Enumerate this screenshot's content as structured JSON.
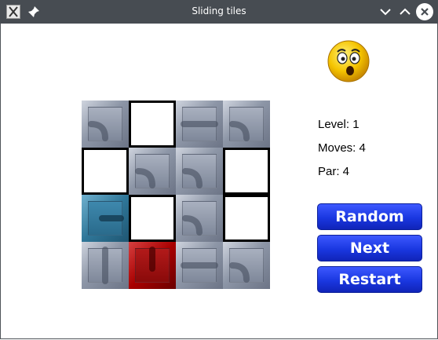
{
  "window": {
    "title": "Sliding tiles",
    "title_bar_color": "#474c52"
  },
  "board": {
    "rows": 4,
    "cols": 4,
    "tiles": [
      {
        "kind": "gray",
        "pipe": "curve"
      },
      {
        "kind": "empty",
        "pipe": "none"
      },
      {
        "kind": "gray",
        "pipe": "horizontal"
      },
      {
        "kind": "gray",
        "pipe": "curve"
      },
      {
        "kind": "empty",
        "pipe": "none"
      },
      {
        "kind": "gray",
        "pipe": "curve"
      },
      {
        "kind": "gray",
        "pipe": "curve"
      },
      {
        "kind": "empty",
        "pipe": "none"
      },
      {
        "kind": "blue",
        "pipe": "start"
      },
      {
        "kind": "empty",
        "pipe": "none"
      },
      {
        "kind": "gray",
        "pipe": "curve"
      },
      {
        "kind": "empty",
        "pipe": "none"
      },
      {
        "kind": "gray",
        "pipe": "vertical"
      },
      {
        "kind": "red",
        "pipe": "end"
      },
      {
        "kind": "gray",
        "pipe": "horizontal"
      },
      {
        "kind": "gray",
        "pipe": "curve"
      }
    ],
    "colors": {
      "gray": "#8d96a7",
      "blue": "#2f7698",
      "red": "#a80000",
      "empty": "#ffffff"
    }
  },
  "status": {
    "level_label": "Level: 1",
    "moves_label": "Moves: 4",
    "par_label": "Par: 4"
  },
  "buttons": {
    "random_label": "Random",
    "next_label": "Next",
    "restart_label": "Restart",
    "color": "#1a37e0"
  },
  "icons": {
    "app": "app-x-icon",
    "pin": "pin-icon",
    "minimize": "chevron-down-icon",
    "maximize": "chevron-up-icon",
    "close": "close-icon",
    "face": "surprised-smiley-icon"
  }
}
